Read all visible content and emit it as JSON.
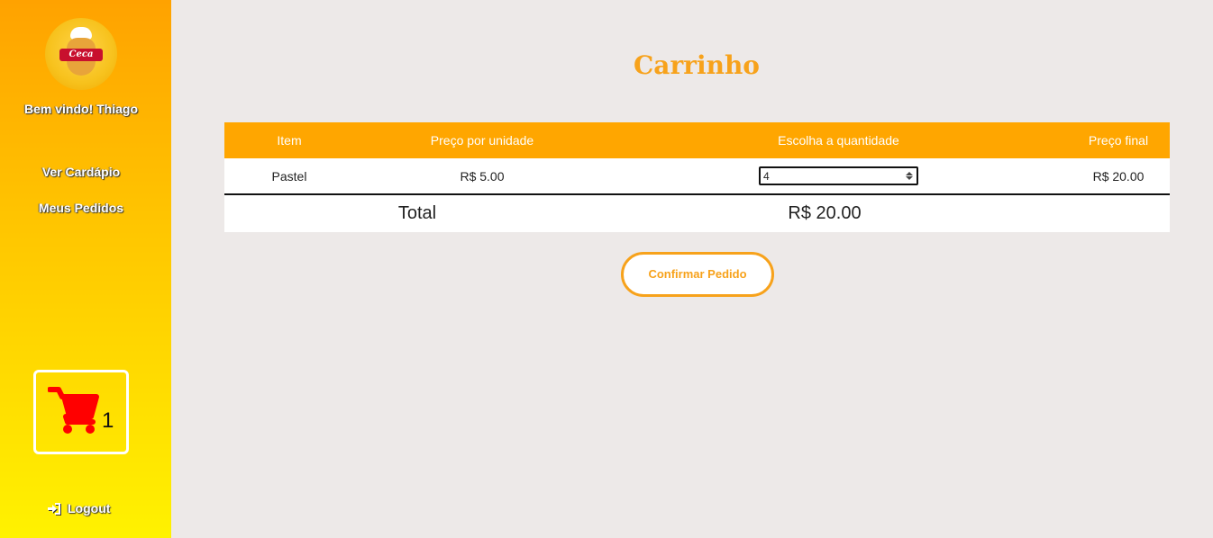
{
  "sidebar": {
    "logo_text": "Ceca",
    "welcome": "Bem vindo! Thiago",
    "nav": [
      {
        "label": "Ver Cardápio"
      },
      {
        "label": "Meus Pedidos"
      }
    ],
    "cart_count": "1",
    "logout_label": "Logout"
  },
  "page": {
    "title": "Carrinho"
  },
  "table": {
    "headers": [
      "Item",
      "Preço por unidade",
      "Escolha a quantidade",
      "Preço final"
    ],
    "rows": [
      {
        "item": "Pastel",
        "unit_price": "R$ 5.00",
        "quantity": "4",
        "final_price": "R$ 20.00"
      }
    ],
    "total_label": "Total",
    "total_value": "R$ 20.00"
  },
  "confirm_label": "Confirmar Pedido",
  "colors": {
    "accent": "#f7a21b",
    "header_bg": "#ffa600",
    "cart_icon": "#ff0000",
    "page_bg": "#ede9e8"
  },
  "icons": {
    "cart": "shopping-cart-icon",
    "logout": "sign-in-icon"
  }
}
